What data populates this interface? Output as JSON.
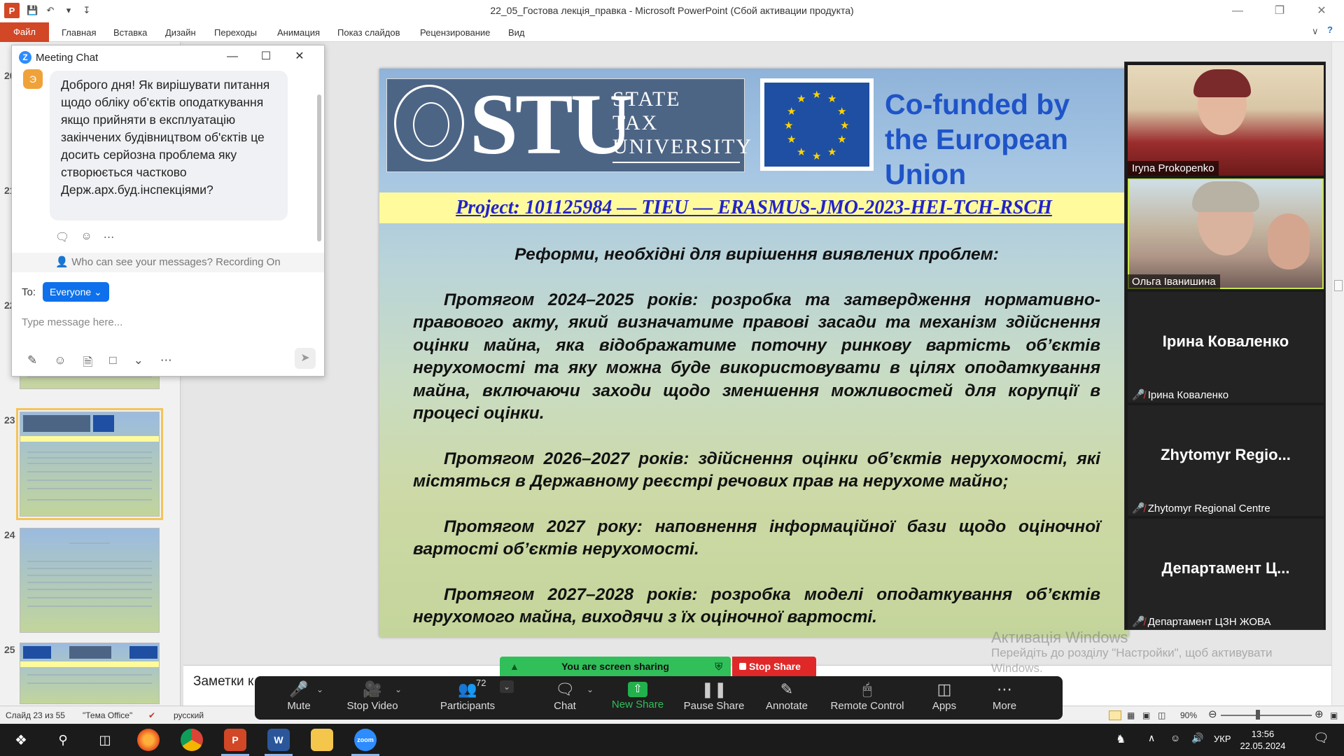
{
  "window": {
    "title": "22_05_Гостова лекція_правка  -  Microsoft PowerPoint (Сбой активации продукта)",
    "app_logo": "P",
    "minimize": "—",
    "maximize": "❐",
    "close": "✕"
  },
  "ribbon": {
    "file": "Файл",
    "tabs": [
      "Главная",
      "Вставка",
      "Дизайн",
      "Переходы",
      "Анимация",
      "Показ слайдов",
      "Рецензирование",
      "Вид"
    ]
  },
  "thumbnails": {
    "numbers": [
      "20",
      "21",
      "22",
      "23",
      "24",
      "25"
    ],
    "selected": "23"
  },
  "slide": {
    "stu_letters": "STU",
    "stu_words": [
      "STATE",
      "TAX",
      "UNIVERSITY"
    ],
    "eu_text_line1": "Co-funded by",
    "eu_text_line2": "the European Union",
    "project": "Project: 101125984 — TIEU — ERASMUS-JMO-2023-HEI-TCH-RSCH",
    "heading": "Реформи, необхідні для вирішення виявлених проблем:",
    "paragraphs": [
      "Протягом 2024–2025 років: розробка та затвердження нормативно-правового акту, який визначатиме правові засади та механізм здійснення оцінки майна, яка відображатиме поточну ринкову вартість об’єктів нерухомості та яку можна буде використовувати в цілях оподаткування майна, включаючи заходи щодо зменшення можливостей для корупції в процесі оцінки.",
      "Протягом 2026–2027 років: здійснення оцінки об’єктів нерухомості, які містяться в Державному реєстрі речових прав на нерухоме майно;",
      "Протягом 2027 року: наповнення інформаційної бази щодо оціночної вартості об’єктів нерухомості.",
      "Протягом 2027–2028 років: розробка моделі оподаткування об’єктів нерухомого майна, виходячи з їх оціночної вартості."
    ]
  },
  "notes": {
    "label": "Заметки к сл"
  },
  "statusbar": {
    "slide_counter": "Слайд 23 из 55",
    "theme": "\"Тема Office\"",
    "language": "русский",
    "zoom": "90%"
  },
  "chat": {
    "title": "Meeting Chat",
    "avatar_letter": "Э",
    "message": "Доброго дня! Як вирішувати питання щодо обліку об'єктів оподаткування якщо прийняти в експлуатацію закінчених будівництвом об'єктів це досить серйозна проблема яку створюється частково Держ.арх.буд.інспекціями?",
    "privacy": "Who can see your messages? Recording On",
    "to_label": "To:",
    "recipient": "Everyone",
    "input_placeholder": "Type message here..."
  },
  "videos": [
    {
      "name": "Iryna Prokopenko",
      "type": "video"
    },
    {
      "name": "Ольга Іванишина",
      "type": "video"
    },
    {
      "big": "Ірина Коваленко",
      "name": "Ірина Коваленко",
      "type": "avatar"
    },
    {
      "big": "Zhytomyr  Regio...",
      "name": "Zhytomyr Regional Centre",
      "type": "avatar"
    },
    {
      "big": "Департамент  Ц...",
      "name": "Департамент ЦЗН ЖОВА",
      "type": "avatar"
    }
  ],
  "zoom_toolbar": {
    "sharing_text": "You are screen sharing",
    "stop_share": "Stop Share",
    "participants_count": "72",
    "items": [
      "Mute",
      "Stop Video",
      "Participants",
      "Chat",
      "New Share",
      "Pause Share",
      "Annotate",
      "Remote Control",
      "Apps",
      "More"
    ]
  },
  "watermark": {
    "line1": "Активація Windows",
    "line2": "Перейдіть до розділу \"Настройки\", щоб активувати",
    "line3": "Windows."
  },
  "taskbar": {
    "lang": "УКР",
    "time": "13:56",
    "date": "22.05.2024",
    "apps": [
      "start-icon",
      "search-icon",
      "task-view-icon",
      "firefox-icon",
      "chrome-icon",
      "powerpoint-icon",
      "word-icon",
      "explorer-icon",
      "zoom-icon"
    ]
  },
  "colors": {
    "ppt_accent": "#d24726",
    "zoom_blue": "#0e71eb",
    "share_green": "#31bf5a",
    "stop_red": "#e02828",
    "project_text": "#2222cc",
    "eu_text": "#1f54c8"
  }
}
